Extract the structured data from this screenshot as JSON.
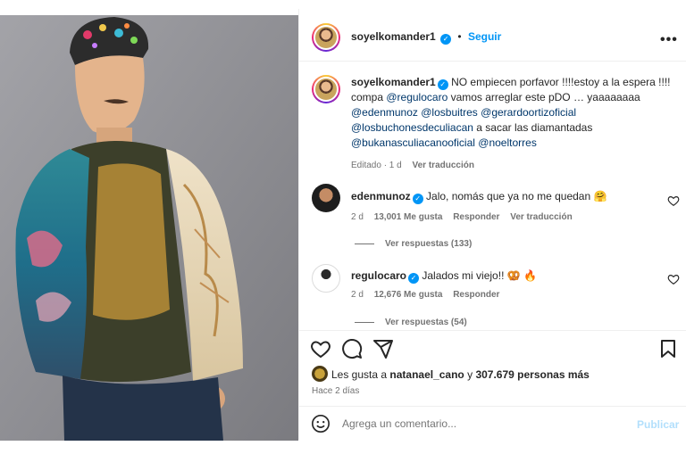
{
  "header": {
    "username": "soyelkomander1",
    "follow_label": "Seguir",
    "separator": "•",
    "more_icon": "more-horizontal-icon"
  },
  "caption": {
    "username": "soyelkomander1",
    "line1": "NO empiecen porfavor !!!!estoy a la espera !!!!",
    "line2_pre": "compa ",
    "line2_mention": "@regulocaro",
    "line2_post": " vamos arreglar este pDO … yaaaaaaaa",
    "mention_edenmunoz": "@edenmunoz",
    "mention_losbuitres": "@losbuitres",
    "mention_gerardo": "@gerardoortizoficial",
    "mention_buchones": "@losbuchonesdeculiacan",
    "text_diamantadas": " a sacar las diamantadas",
    "mention_bukanas": "@bukanasculiacanooficial",
    "mention_noel": "@noeltorres",
    "edited": "Editado · 1 d",
    "translate": "Ver traducción"
  },
  "comments": [
    {
      "username": "edenmunoz",
      "text": "Jalo, nomás que ya no me quedan 🤗",
      "time": "2 d",
      "likes": "13,001 Me gusta",
      "reply": "Responder",
      "translate": "Ver traducción",
      "replies": "Ver respuestas (133)"
    },
    {
      "username": "regulocaro",
      "text": "Jalados mi viejo!! 🥨 🔥",
      "time": "2 d",
      "likes": "12,676 Me gusta",
      "reply": "Responder",
      "replies": "Ver respuestas (54)"
    }
  ],
  "likes": {
    "prefix": "Les gusta a ",
    "user": "natanael_cano",
    "connector": " y ",
    "count": "307.679 personas más"
  },
  "posted": "Hace 2 días",
  "composer": {
    "placeholder": "Agrega un comentario...",
    "publish": "Publicar"
  },
  "colors": {
    "follow": "#0095f6",
    "verified": "#0095f6",
    "publish_disabled": "#b2dffc"
  }
}
